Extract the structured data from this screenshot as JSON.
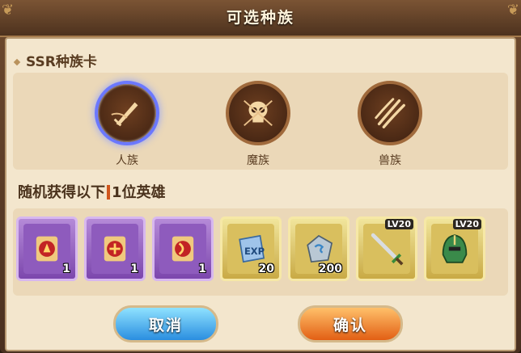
{
  "dialog": {
    "title": "可选种族"
  },
  "section": {
    "title": "SSR种族卡"
  },
  "races": [
    {
      "label": "人族",
      "icon": "sword-icon",
      "selected": true
    },
    {
      "label": "魔族",
      "icon": "skull-icon",
      "selected": false
    },
    {
      "label": "兽族",
      "icon": "claw-icon",
      "selected": false
    }
  ],
  "reward_note": {
    "prefix": "随机获得以下",
    "count": "1",
    "suffix": "位英雄"
  },
  "rewards": [
    {
      "icon": "red-rune-scroll-icon",
      "count": "1",
      "rarity": "purple"
    },
    {
      "icon": "red-rune-scroll-icon",
      "count": "1",
      "rarity": "purple"
    },
    {
      "icon": "red-rune-scroll-icon",
      "count": "1",
      "rarity": "purple"
    },
    {
      "icon": "exp-book-icon",
      "count": "20",
      "rarity": "gold"
    },
    {
      "icon": "stone-icon",
      "count": "200",
      "rarity": "gold"
    },
    {
      "icon": "sword-icon",
      "level": "LV20",
      "rarity": "gold"
    },
    {
      "icon": "helmet-icon",
      "level": "LV20",
      "rarity": "gold"
    }
  ],
  "buttons": {
    "cancel": "取消",
    "confirm": "确认"
  },
  "colors": {
    "accent_blue": "#2a8ee0",
    "accent_orange": "#e25f14",
    "selected_glow": "#6b78ff"
  }
}
